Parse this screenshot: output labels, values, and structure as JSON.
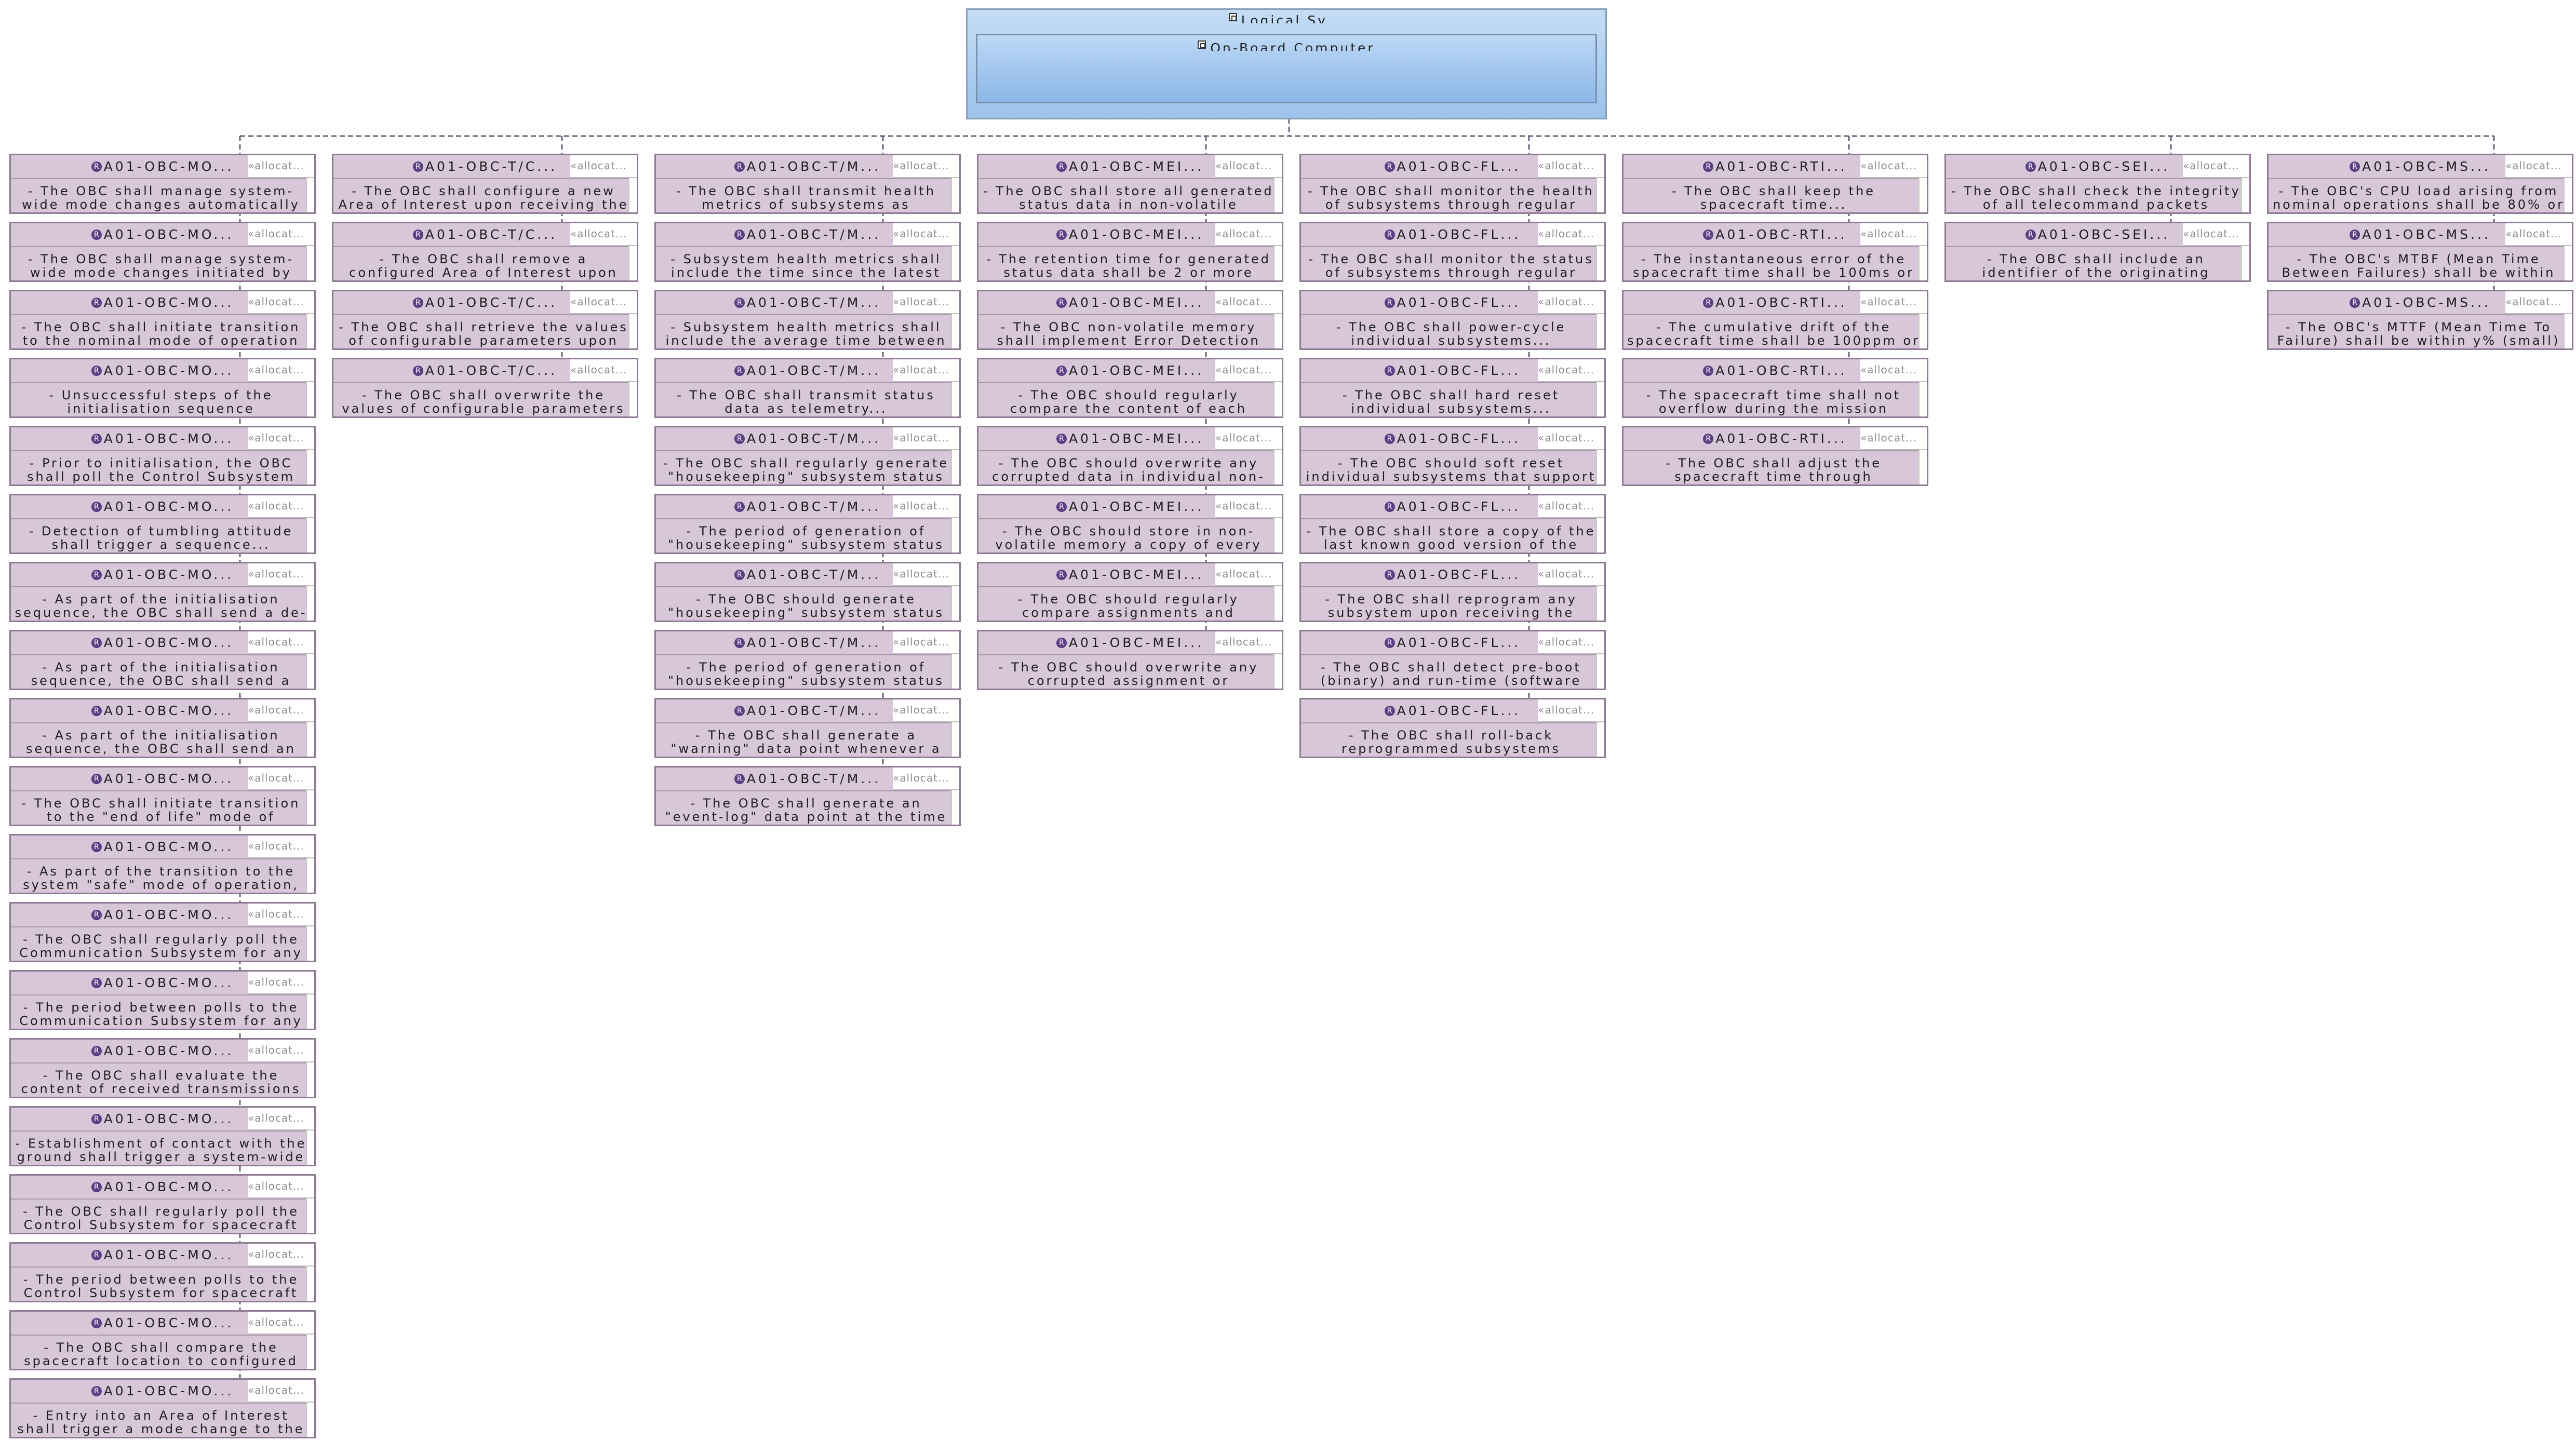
{
  "logical_system": {
    "title": "Logical Sy...",
    "obc_title": "On-Board Computer"
  },
  "stereotype": "«allocat...",
  "columns": [
    {
      "requirements": [
        {
          "id": "A01-OBC-MO...",
          "text": "- The OBC shall manage system-wide mode changes automatically initiated by stringent..."
        },
        {
          "id": "A01-OBC-MO...",
          "text": "- The OBC shall manage system-wide mode changes initiated by telecommand..."
        },
        {
          "id": "A01-OBC-MO...",
          "text": "- The OBC shall initiate transition to the nominal mode of operation after successful..."
        },
        {
          "id": "A01-OBC-MO...",
          "text": "- Unsuccessful steps of the initialisation sequence (automatically? manually?) triggered..."
        },
        {
          "id": "A01-OBC-MO...",
          "text": "- Prior to initialisation, the OBC shall poll the Control Subsystem for detecting..."
        },
        {
          "id": "A01-OBC-MO...",
          "text": "- Detection of tumbling attitude shall trigger a sequence..."
        },
        {
          "id": "A01-OBC-MO...",
          "text": "- As part of the initialisation sequence, the OBC shall send a de-tumble signal to the Control Subsystem..."
        },
        {
          "id": "A01-OBC-MO...",
          "text": "- As part of the initialisation sequence, the OBC shall send a solar array deployment signal to the..."
        },
        {
          "id": "A01-OBC-MO...",
          "text": "- As part of the initialisation sequence, the OBC shall send an antenna deployment signal to the..."
        },
        {
          "id": "A01-OBC-MO...",
          "text": "- The OBC shall initiate transition to the \"end of life\" mode of operation upon telecommand..."
        },
        {
          "id": "A01-OBC-MO...",
          "text": "- As part of the transition to the system \"safe\" mode of operation, the OBC shall initiate..."
        },
        {
          "id": "A01-OBC-MO...",
          "text": "- The OBC shall regularly poll the Communication Subsystem for any received transmissions..."
        },
        {
          "id": "A01-OBC-MO...",
          "text": "- The period between polls to the Communication Subsystem for any received transmissions..."
        },
        {
          "id": "A01-OBC-MO...",
          "text": "- The OBC shall evaluate the content of received transmissions to determine establishment of contact..."
        },
        {
          "id": "A01-OBC-MO...",
          "text": "- Establishment of contact with the ground shall trigger a system-wide mode change..."
        },
        {
          "id": "A01-OBC-MO...",
          "text": "- The OBC shall regularly poll the Control Subsystem for spacecraft location over the Earth..."
        },
        {
          "id": "A01-OBC-MO...",
          "text": "- The period between polls to the Control Subsystem for spacecraft location shall be (small)..."
        },
        {
          "id": "A01-OBC-MO...",
          "text": "- The OBC shall compare the spacecraft location to configured Areas of Interest to determine..."
        },
        {
          "id": "A01-OBC-MO...",
          "text": "- Entry into an Area of Interest shall trigger a mode change to the appropriate \"imaging\"..."
        }
      ]
    },
    {
      "requirements": [
        {
          "id": "A01-OBC-T/C...",
          "text": "- The OBC shall configure a new Area of Interest upon receiving the appropriate telecommand..."
        },
        {
          "id": "A01-OBC-T/C...",
          "text": "- The OBC shall remove a configured Area of Interest upon receiving the appropriate telecommand..."
        },
        {
          "id": "A01-OBC-T/C...",
          "text": "- The OBC shall retrieve the values of configurable parameters upon receiving the appropriate..."
        },
        {
          "id": "A01-OBC-T/C...",
          "text": "- The OBC shall overwrite the values of configurable parameters upon receiving the appropriate..."
        }
      ]
    },
    {
      "requirements": [
        {
          "id": "A01-OBC-T/M...",
          "text": "- The OBC shall transmit health metrics of subsystems as telemetry..."
        },
        {
          "id": "A01-OBC-T/M...",
          "text": "- Subsystem health metrics shall include the time since the latest heartbeat signal received..."
        },
        {
          "id": "A01-OBC-T/M...",
          "text": "- Subsystem health metrics shall include the average time between heartbeat signals..."
        },
        {
          "id": "A01-OBC-T/M...",
          "text": "- The OBC shall transmit status data as telemetry..."
        },
        {
          "id": "A01-OBC-T/M...",
          "text": "- The OBC shall regularly generate \"housekeeping\" subsystem status data points during..."
        },
        {
          "id": "A01-OBC-T/M...",
          "text": "- The period of generation of \"housekeeping\" subsystem status data points during..."
        },
        {
          "id": "A01-OBC-T/M...",
          "text": "- The OBC should generate \"housekeeping\" subsystem status data points outside of..."
        },
        {
          "id": "A01-OBC-T/M...",
          "text": "- The period of generation of \"housekeeping\" subsystem status data points outside of..."
        },
        {
          "id": "A01-OBC-T/M...",
          "text": "- The OBC shall generate a \"warning\" data point whenever a parameter is..."
        },
        {
          "id": "A01-OBC-T/M...",
          "text": "- The OBC shall generate an \"event-log\" data point at the time of each triggered..."
        }
      ]
    },
    {
      "requirements": [
        {
          "id": "A01-OBC-MEI...",
          "text": "- The OBC shall store all generated status data in non-volatile memory..."
        },
        {
          "id": "A01-OBC-MEI...",
          "text": "- The retention time for generated status data shall be 2 or more times the longest..."
        },
        {
          "id": "A01-OBC-MEI...",
          "text": "- The OBC non-volatile memory shall implement Error Detection And Correcting logic..."
        },
        {
          "id": "A01-OBC-MEI...",
          "text": "- The OBC should regularly compare the content of each individual non-volatile memory unit..."
        },
        {
          "id": "A01-OBC-MEI...",
          "text": "- The OBC should overwrite any corrupted data in individual non-volatile memory units..."
        },
        {
          "id": "A01-OBC-MEI...",
          "text": "- The OBC should store in non-volatile memory a copy of every assignment and instruction loaded..."
        },
        {
          "id": "A01-OBC-MEI...",
          "text": "- The OBC should regularly compare assignments and instructions in volatile memory against..."
        },
        {
          "id": "A01-OBC-MEI...",
          "text": "- The OBC should overwrite any corrupted assignment or instruction with its copy stored in non-volatile..."
        }
      ]
    },
    {
      "requirements": [
        {
          "id": "A01-OBC-FL...",
          "text": "- The OBC shall monitor the health of subsystems through regular heartbeat signals..."
        },
        {
          "id": "A01-OBC-FL...",
          "text": "- The OBC shall monitor the status of subsystems through regular data collection..."
        },
        {
          "id": "A01-OBC-FL...",
          "text": "- The OBC shall power-cycle individual subsystems..."
        },
        {
          "id": "A01-OBC-FL...",
          "text": "- The OBC shall hard reset individual subsystems..."
        },
        {
          "id": "A01-OBC-FL...",
          "text": "- The OBC should soft reset individual subsystems that support this operation..."
        },
        {
          "id": "A01-OBC-FL...",
          "text": "- The OBC shall store a copy of the last known good version of the binary software for each..."
        },
        {
          "id": "A01-OBC-FL...",
          "text": "- The OBC shall reprogram any subsystem upon receiving the appropriate telecommand..."
        },
        {
          "id": "A01-OBC-FL...",
          "text": "- The OBC shall detect pre-boot (binary) and run-time (software hanging) failure of reprogrammed..."
        },
        {
          "id": "A01-OBC-FL...",
          "text": "- The OBC shall roll-back reprogrammed subsystems experiencing failure to the last known good..."
        }
      ]
    },
    {
      "requirements": [
        {
          "id": "A01-OBC-RTI...",
          "text": "- The OBC shall keep the spacecraft time..."
        },
        {
          "id": "A01-OBC-RTI...",
          "text": "- The instantaneous error of the spacecraft time shall be 100ms or lower at all times..."
        },
        {
          "id": "A01-OBC-RTI...",
          "text": "- The cumulative drift of the spacecraft time shall be 100ppm or lower over the nominal..."
        },
        {
          "id": "A01-OBC-RTI...",
          "text": "- The spacecraft time shall not overflow during the mission lifetime..."
        },
        {
          "id": "A01-OBC-RTI...",
          "text": "- The OBC shall adjust the spacecraft time through synchronisation exchanges with the ground..."
        }
      ]
    },
    {
      "requirements": [
        {
          "id": "A01-OBC-SEI...",
          "text": "- The OBC shall check the integrity of all telecommand packets through a..."
        },
        {
          "id": "A01-OBC-SEI...",
          "text": "- The OBC shall include an identifier of the originating spacecraft to all transmissions..."
        }
      ]
    },
    {
      "requirements": [
        {
          "id": "A01-OBC-MS...",
          "text": "- The OBC's CPU load arising from nominal operations shall be 80% or lower..."
        },
        {
          "id": "A01-OBC-MS...",
          "text": "- The OBC's MTBF (Mean Time Between Failures) shall be within X% (large)..."
        },
        {
          "id": "A01-OBC-MS...",
          "text": "- The OBC's MTTF (Mean Time To Failure) shall be within y% (small) of the nominal..."
        }
      ]
    }
  ]
}
